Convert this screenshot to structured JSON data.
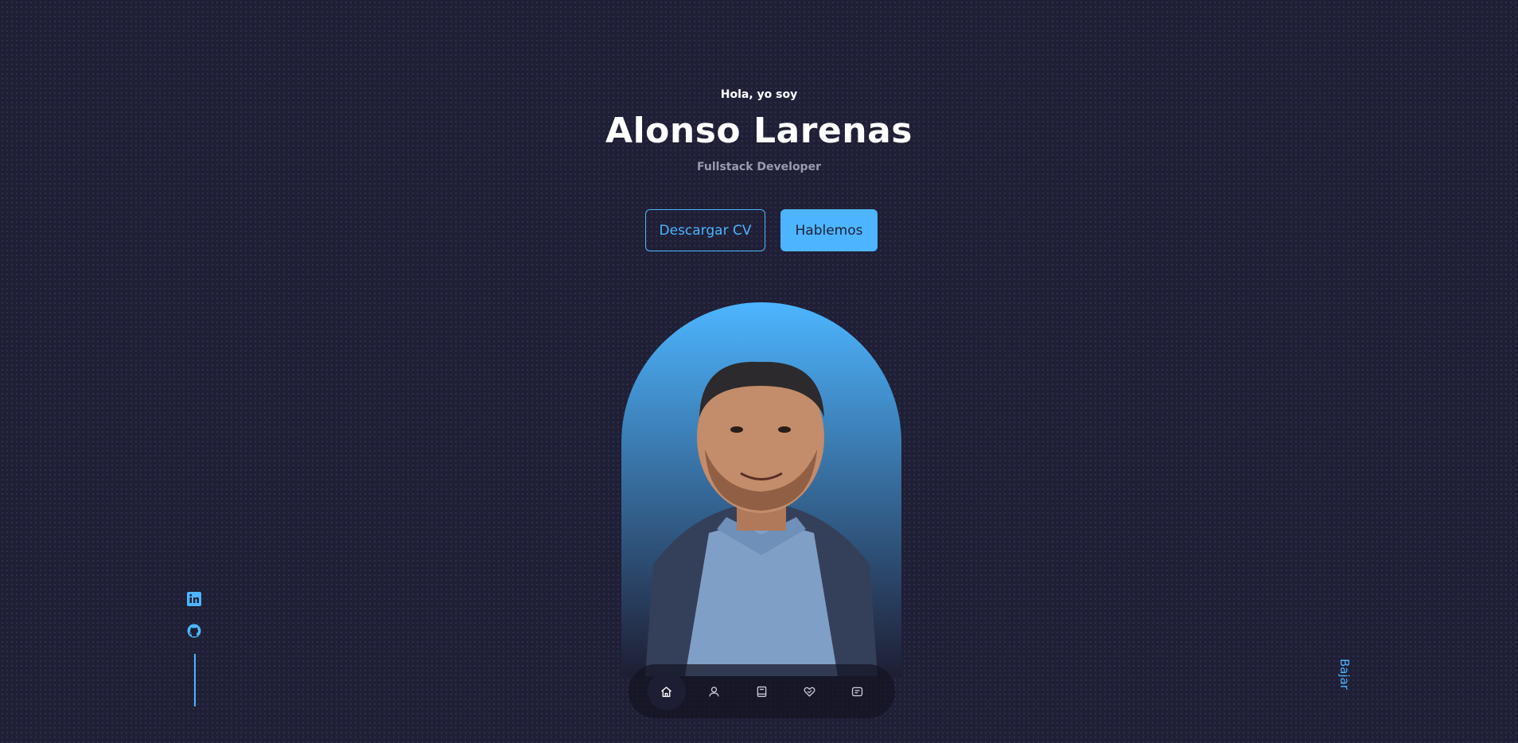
{
  "header": {
    "greeting": "Hola, yo soy",
    "name": "Alonso Larenas",
    "role": "Fullstack Developer"
  },
  "cta": {
    "download_cv": "Descargar CV",
    "talk": "Hablemos"
  },
  "portrait": {
    "icon": "person-photo"
  },
  "socials": {
    "items": [
      {
        "icon": "linkedin-icon"
      },
      {
        "icon": "github-icon"
      }
    ]
  },
  "scroll": {
    "label": "Bajar"
  },
  "nav": {
    "items": [
      {
        "icon": "home-icon",
        "active": true
      },
      {
        "icon": "user-icon",
        "active": false
      },
      {
        "icon": "book-icon",
        "active": false
      },
      {
        "icon": "heart-icon",
        "active": false
      },
      {
        "icon": "message-icon",
        "active": false
      }
    ]
  },
  "colors": {
    "background": "#1f1f35",
    "accent": "#4db5ff",
    "text": "#ffffff",
    "muted_text": "#9a9ab0"
  }
}
